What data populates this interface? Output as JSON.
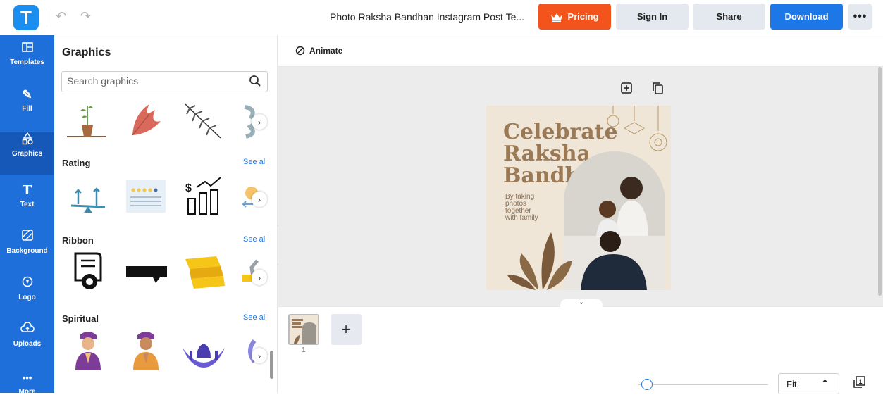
{
  "app": {
    "logo_letter": "T",
    "doc_title": "Photo Raksha Bandhan Instagram Post Te..."
  },
  "header": {
    "pricing": "Pricing",
    "signin": "Sign In",
    "share": "Share",
    "download": "Download",
    "more": "•••"
  },
  "nav": {
    "items": [
      {
        "label": "Templates",
        "icon": "templates-icon"
      },
      {
        "label": "Fill",
        "icon": "pencil-icon"
      },
      {
        "label": "Graphics",
        "icon": "shapes-icon"
      },
      {
        "label": "Text",
        "icon": "text-icon"
      },
      {
        "label": "Background",
        "icon": "background-icon"
      },
      {
        "label": "Logo",
        "icon": "logo-icon"
      },
      {
        "label": "Uploads",
        "icon": "upload-cloud-icon"
      },
      {
        "label": "More",
        "icon": "more-icon"
      }
    ],
    "active": "Graphics"
  },
  "panel": {
    "title": "Graphics",
    "search_placeholder": "Search graphics",
    "sections": [
      {
        "label": "Rating",
        "see_all": "See all"
      },
      {
        "label": "Ribbon",
        "see_all": "See all"
      },
      {
        "label": "Spiritual",
        "see_all": "See all"
      }
    ]
  },
  "toolbar": {
    "animate": "Animate"
  },
  "design": {
    "headline_lines": [
      "Celebrate",
      "Raksha",
      "Bandhan"
    ],
    "subcopy_lines": [
      "By taking",
      "photos",
      "together",
      "with family"
    ]
  },
  "pages": {
    "current": "1",
    "add": "+"
  },
  "zoom": {
    "value": "Fit"
  },
  "colors": {
    "brand": "#1e6fd9",
    "pricing": "#f2541b",
    "download": "#1c78e6",
    "design_bg": "#efe6d7",
    "headline": "#9b7954"
  }
}
